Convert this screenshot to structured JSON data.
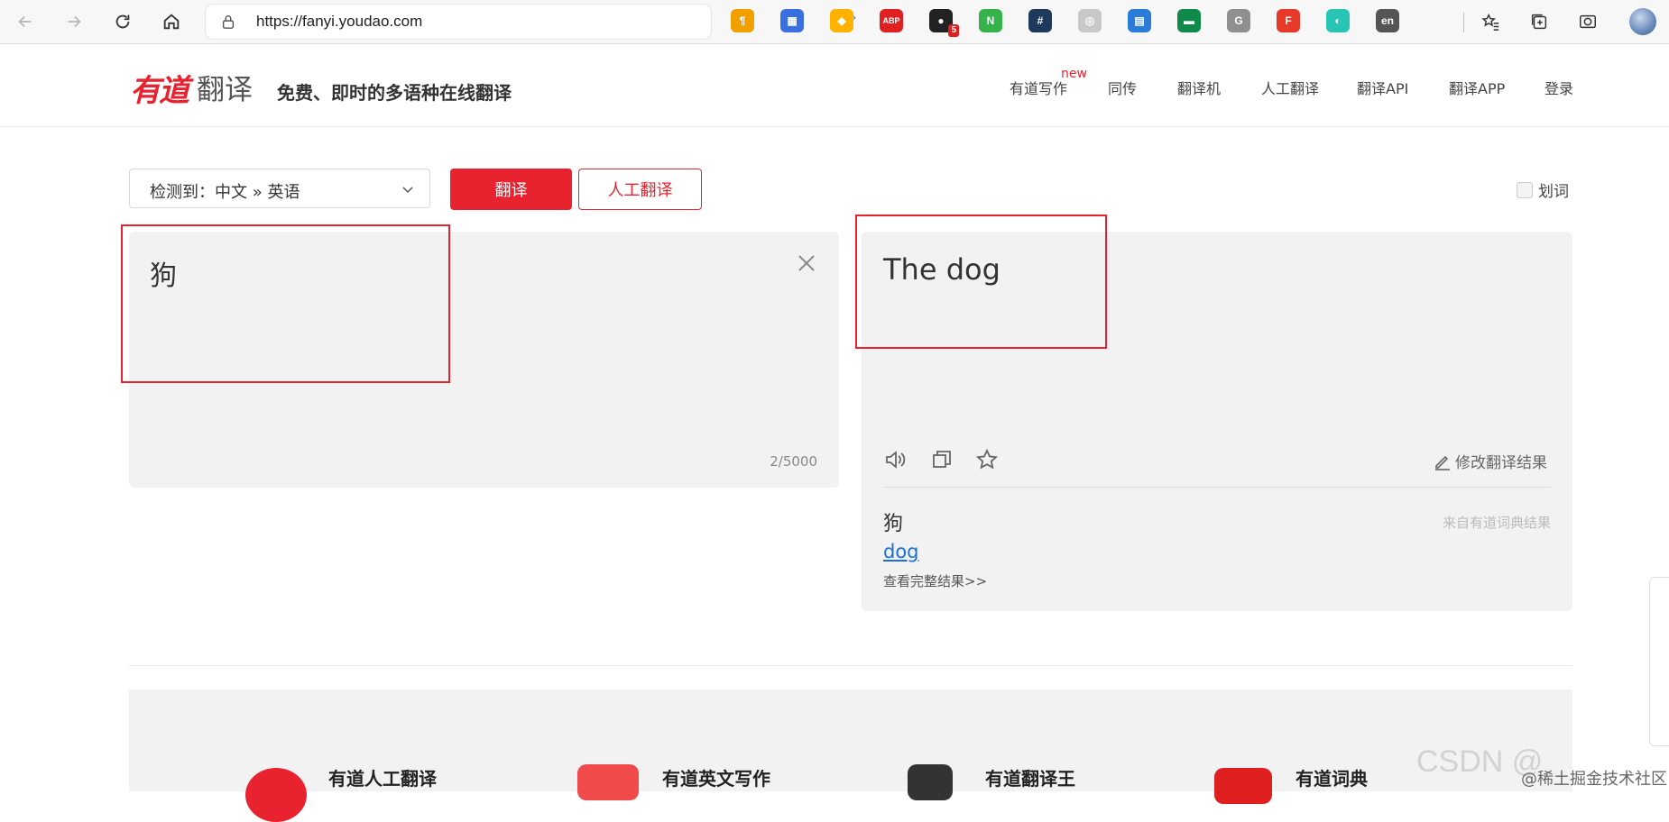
{
  "browser": {
    "url": "https://fanyi.youdao.com",
    "extensions": [
      {
        "name": "pilcrow-icon",
        "color": "#f2a000",
        "glyph": "¶"
      },
      {
        "name": "apps-icon",
        "color": "#3a6fe0",
        "glyph": "▦"
      },
      {
        "name": "shield-icon",
        "color": "#ffb300",
        "glyph": "◆"
      },
      {
        "name": "adblock-icon",
        "color": "#e02020",
        "glyph": "ABP"
      },
      {
        "name": "ghost-icon",
        "color": "#222222",
        "glyph": "●",
        "badge": "5"
      },
      {
        "name": "n-icon",
        "color": "#35b34a",
        "glyph": "N"
      },
      {
        "name": "hash-icon",
        "color": "#1d3a5c",
        "glyph": "#"
      },
      {
        "name": "globe-icon",
        "color": "#c8c8c8",
        "glyph": "◎"
      },
      {
        "name": "file-download-icon",
        "color": "#2b7bd9",
        "glyph": "▤"
      },
      {
        "name": "flag-icon",
        "color": "#0f8a4b",
        "glyph": "▬"
      },
      {
        "name": "g-icon",
        "color": "#8f8f8f",
        "glyph": "G"
      },
      {
        "name": "f-icon",
        "color": "#e83a2a",
        "glyph": "F"
      },
      {
        "name": "circle-q-icon",
        "color": "#28c5b5",
        "glyph": "◐"
      },
      {
        "name": "translate-ext-icon",
        "color": "#555555",
        "glyph": "en"
      }
    ]
  },
  "header": {
    "logo_text": "有道",
    "logo_fanyi": "翻译",
    "slogan": "免费、即时的多语种在线翻译",
    "nav": [
      {
        "label": "有道写作",
        "new": "new"
      },
      {
        "label": "同传"
      },
      {
        "label": "翻译机"
      },
      {
        "label": "人工翻译"
      },
      {
        "label": "翻译API"
      },
      {
        "label": "翻译APP"
      },
      {
        "label": "登录"
      }
    ]
  },
  "controls": {
    "lang_select": "检测到：中文 » 英语",
    "translate_button": "翻译",
    "human_button": "人工翻译",
    "huaci": "划词"
  },
  "source": {
    "text": "狗",
    "count": "2/5000"
  },
  "target": {
    "text": "The dog",
    "edit_label": "修改翻译结果",
    "dict_word": "狗",
    "dict_source": "来自有道词典结果",
    "dict_link": "dog",
    "dict_more": "查看完整结果>>"
  },
  "products": [
    {
      "label": "有道人工翻译",
      "color": "#e8222e"
    },
    {
      "label": "有道英文写作",
      "color": "#f04a4a"
    },
    {
      "label": "有道翻译王",
      "color": "#333333"
    },
    {
      "label": "有道词典",
      "color": "#e02020"
    }
  ],
  "watermark": {
    "csdn": "CSDN @",
    "juejin": "@稀土掘金技术社区"
  }
}
